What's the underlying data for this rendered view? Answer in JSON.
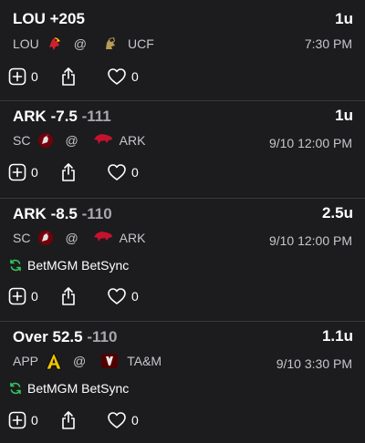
{
  "picks": [
    {
      "team_side": "LOU",
      "line": "+205",
      "odds": "",
      "units": "1u",
      "away": "LOU",
      "at": "@",
      "home": "UCF",
      "away_logo": "louisville-cardinal-logo",
      "home_logo": "ucf-knight-logo",
      "time": "7:30 PM",
      "sync_label": "",
      "add_count": "0",
      "like_count": "0"
    },
    {
      "team_side": "ARK",
      "line": "-7.5",
      "odds": "-111",
      "units": "1u",
      "away": "SC",
      "at": "@",
      "home": "ARK",
      "away_logo": "south-carolina-gamecock-logo",
      "home_logo": "arkansas-razorback-logo",
      "time": "9/10 12:00 PM",
      "sync_label": "",
      "add_count": "0",
      "like_count": "0"
    },
    {
      "team_side": "ARK",
      "line": "-8.5",
      "odds": "-110",
      "units": "2.5u",
      "away": "SC",
      "at": "@",
      "home": "ARK",
      "away_logo": "south-carolina-gamecock-logo",
      "home_logo": "arkansas-razorback-logo",
      "time": "9/10 12:00 PM",
      "sync_label": "BetMGM BetSync",
      "add_count": "0",
      "like_count": "0"
    },
    {
      "team_side": "Over",
      "line": "52.5",
      "odds": "-110",
      "units": "1.1u",
      "away": "APP",
      "at": "@",
      "home": "TA&M",
      "away_logo": "app-state-a-logo",
      "home_logo": "texas-am-logo",
      "time": "9/10 3:30 PM",
      "sync_label": "BetMGM BetSync",
      "add_count": "0",
      "like_count": "0"
    }
  ],
  "colors": {
    "background": "#1c1c1e",
    "divider": "#3a3a3c",
    "odds_gray": "#a7a7ad",
    "sync_green": "#34c759",
    "louisville_red": "#d0202e",
    "ucf_gold": "#b89b55",
    "gamecock_garnet": "#73000a",
    "razorback_red": "#c4122f",
    "app_gold": "#f2c500",
    "aggie_maroon": "#500000"
  },
  "icons": {
    "add": "plus-square-icon",
    "share": "share-icon",
    "like": "heart-icon",
    "sync": "sync-icon"
  }
}
